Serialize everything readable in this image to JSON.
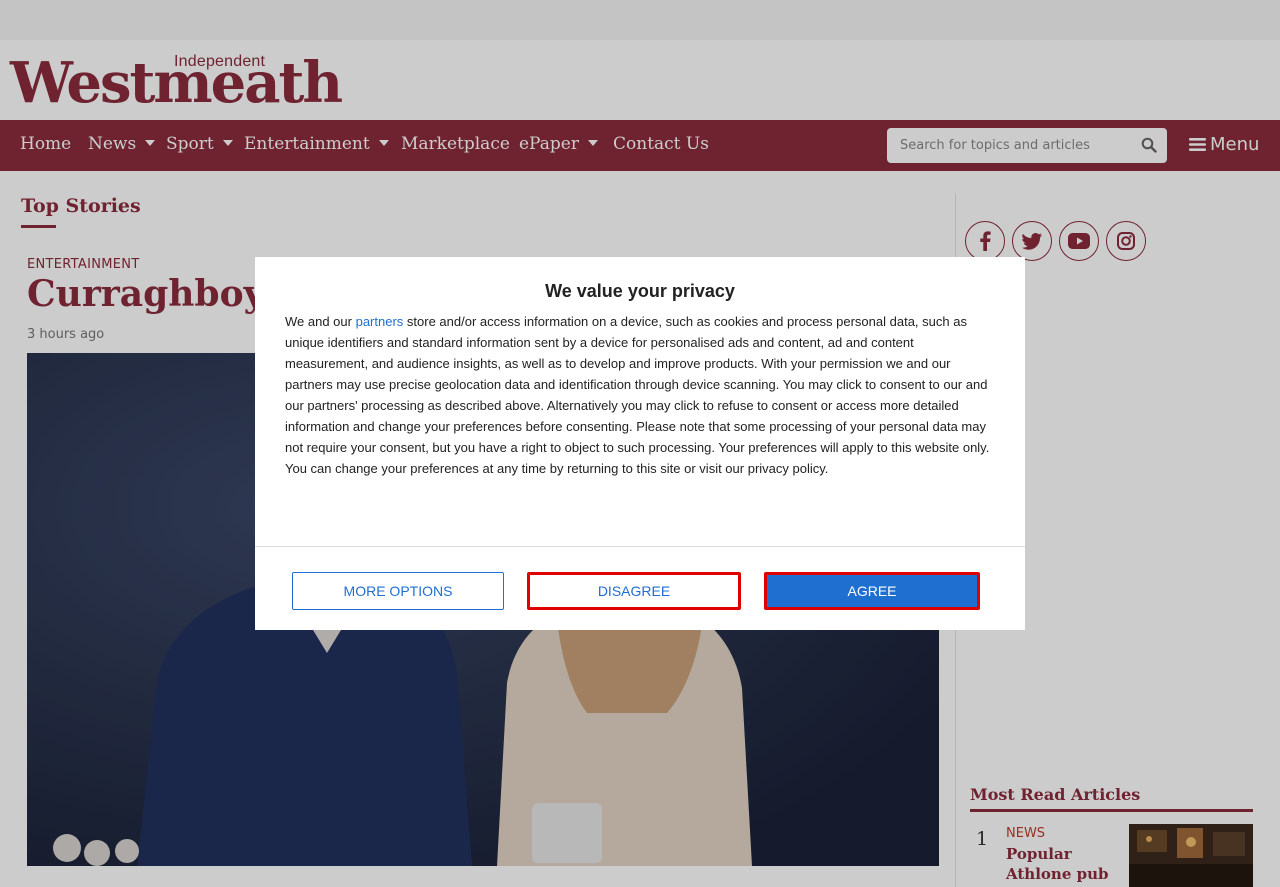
{
  "logo": {
    "small_text": "Independent",
    "big_text": "Westmeath"
  },
  "nav": {
    "items": [
      {
        "label": "Home",
        "dropdown": false
      },
      {
        "label": "News",
        "dropdown": true
      },
      {
        "label": "Sport",
        "dropdown": true
      },
      {
        "label": "Entertainment",
        "dropdown": true
      },
      {
        "label": "Marketplace",
        "dropdown": false
      },
      {
        "label": "ePaper",
        "dropdown": true
      },
      {
        "label": "Contact Us",
        "dropdown": false
      }
    ],
    "search_placeholder": "Search for topics and articles",
    "menu_label": "Menu"
  },
  "main": {
    "section_title": "Top Stories",
    "article": {
      "category": "ENTERTAINMENT",
      "headline": "Curraghboy a",
      "time": "3 hours ago"
    }
  },
  "sidebar": {
    "social_icons": [
      "facebook-icon",
      "twitter-icon",
      "youtube-icon",
      "instagram-icon"
    ],
    "most_read_title": "Most Read Articles",
    "most_read": [
      {
        "rank": "1",
        "category": "NEWS",
        "headline": "Popular Athlone pub"
      }
    ]
  },
  "consent": {
    "title": "We value your privacy",
    "body_before_link": "We and our ",
    "link_text": "partners",
    "body_after_link": " store and/or access information on a device, such as cookies and process personal data, such as unique identifiers and standard information sent by a device for personalised ads and content, ad and content measurement, and audience insights, as well as to develop and improve products. With your permission we and our partners may use precise geolocation data and identification through device scanning. You may click to consent to our and our partners' processing as described above. Alternatively you may click to refuse to consent or access more detailed information and change your preferences before consenting. Please note that some processing of your personal data may not require your consent, but you have a right to object to such processing. Your preferences will apply to this website only. You can change your preferences at any time by returning to this site or visit our privacy policy.",
    "buttons": {
      "more_options": "MORE OPTIONS",
      "disagree": "DISAGREE",
      "agree": "AGREE"
    }
  },
  "colors": {
    "brand": "#8b2b3b",
    "consent_blue": "#1f6fd1",
    "highlight_red": "#e00000"
  }
}
